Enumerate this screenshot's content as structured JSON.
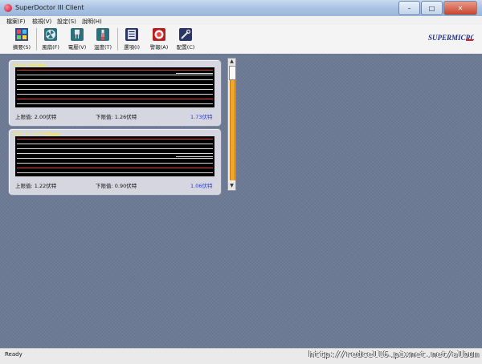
{
  "window": {
    "title": "SuperDoctor III Client"
  },
  "menu": [
    "檔案(F)",
    "檢視(V)",
    "設定(S)",
    "說明(H)"
  ],
  "toolbar": [
    {
      "label": "摘要(S)",
      "icon": "summary-icon"
    },
    {
      "label": "風扇(F)",
      "icon": "fan-icon"
    },
    {
      "label": "電壓(V)",
      "icon": "voltage-icon"
    },
    {
      "label": "溫度(T)",
      "icon": "thermometer-icon"
    },
    {
      "label": "選項(I)",
      "icon": "options-icon"
    },
    {
      "label": "警報(A)",
      "icon": "alarm-icon"
    },
    {
      "label": "配置(C)",
      "icon": "config-icon"
    }
  ],
  "logo": {
    "text": "SUPERMICRO"
  },
  "panels": [
    {
      "title": "Vcpu Voltage",
      "upper": "上限值: 2.00伏特",
      "lower": "下限值: 1.26伏特",
      "current": "1.73伏特"
    },
    {
      "title": "PCH 1.05V Voltage",
      "upper": "上限值: 1.22伏特",
      "lower": "下限值: 0.90伏特",
      "current": "1.06伏特"
    }
  ],
  "status": {
    "text": "Ready"
  },
  "watermark": "http://redcell6.pixnet.net/album",
  "colors": {
    "title_text": "#f2e84a",
    "current_value": "#2b3fd6",
    "limit_line": "#e23b3b",
    "scroll_track": "#f2a62a"
  }
}
